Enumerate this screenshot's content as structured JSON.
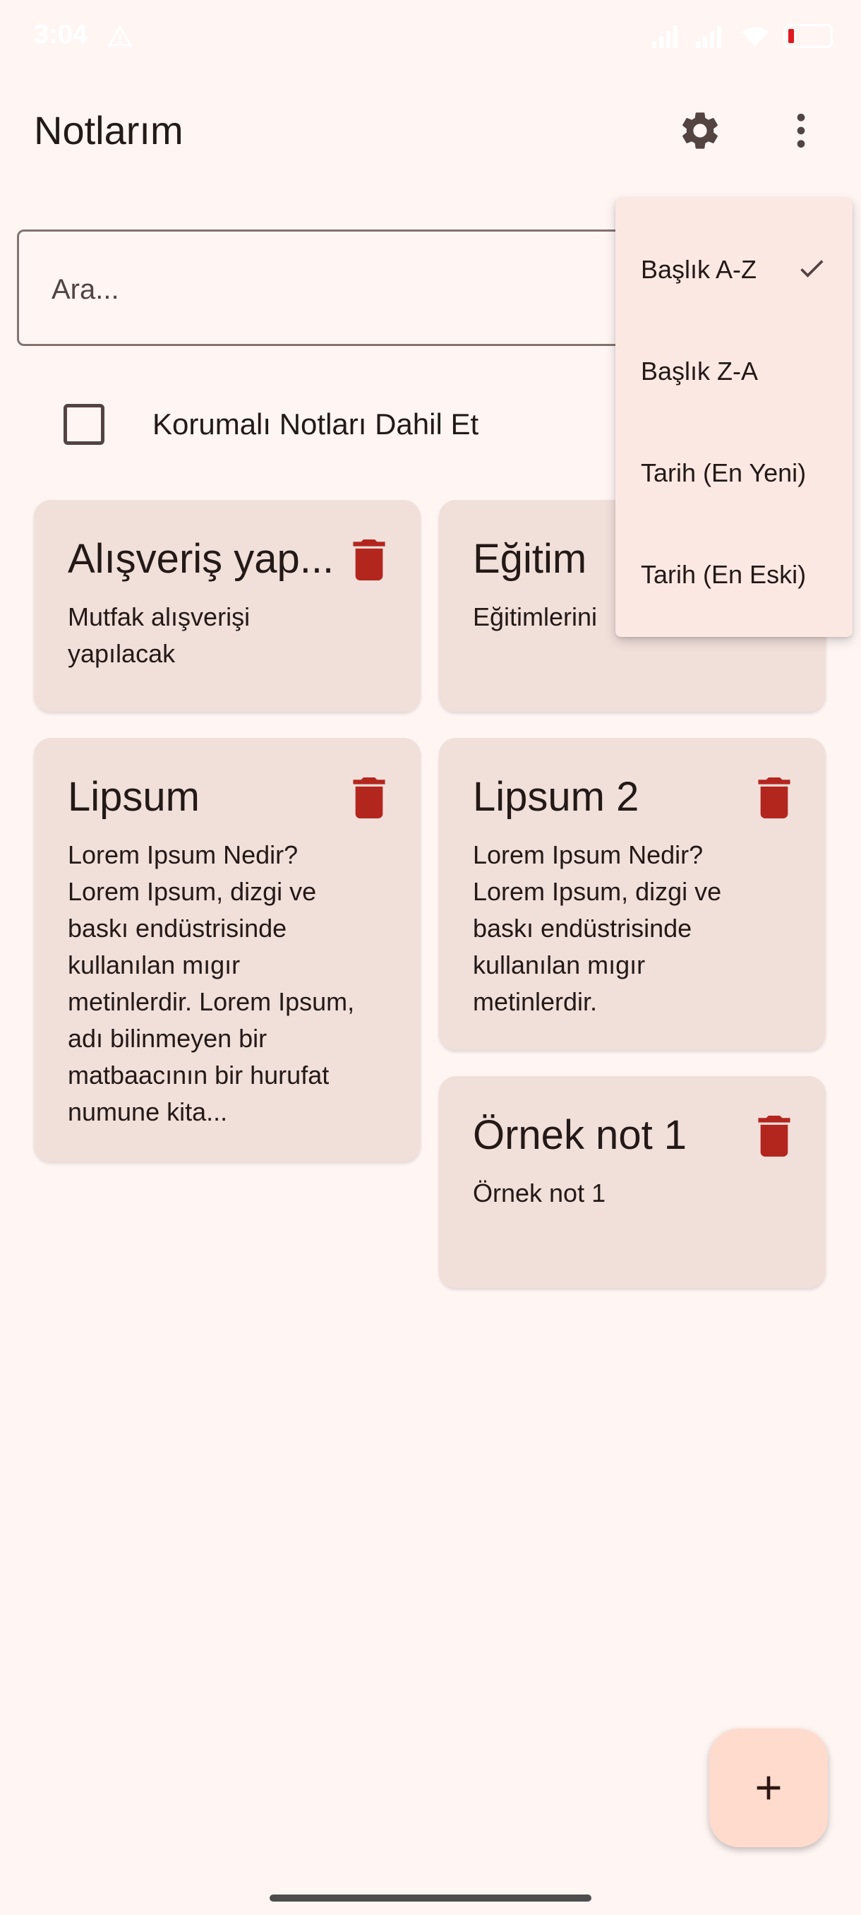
{
  "status_bar": {
    "time": "3:04"
  },
  "app_bar": {
    "title": "Notlarım",
    "settings_icon": "gear-icon",
    "more_icon": "more-vert-icon"
  },
  "search": {
    "placeholder": "Ara..."
  },
  "filter": {
    "include_protected_label": "Korumalı Notları Dahil Et",
    "checked": false
  },
  "sort_menu": {
    "items": [
      {
        "label": "Başlık A-Z",
        "selected": true
      },
      {
        "label": "Başlık Z-A",
        "selected": false
      },
      {
        "label": "Tarih (En Yeni)",
        "selected": false
      },
      {
        "label": "Tarih (En Eski)",
        "selected": false
      }
    ]
  },
  "notes": [
    {
      "title": "Alışveriş yap...",
      "body": "Mutfak alışverişi yapılacak"
    },
    {
      "title": "Eğitim",
      "body": "Eğitimlerini"
    },
    {
      "title": "Lipsum",
      "body": "Lorem Ipsum Nedir? Lorem Ipsum, dizgi ve baskı endüstrisinde kullanılan mıgır metinlerdir. Lorem Ipsum, adı bilinmeyen bir matbaacının bir hurufat numune kita..."
    },
    {
      "title": "Lipsum 2",
      "body": "Lorem Ipsum Nedir? Lorem Ipsum, dizgi ve baskı endüstrisinde kullanılan mıgır metinlerdir."
    },
    {
      "title": "Örnek not 1",
      "body": "Örnek not 1"
    }
  ],
  "fab": {
    "icon": "add-icon"
  },
  "colors": {
    "background": "#FFF6F4",
    "card": "#F1DFDA",
    "menu": "#FBE8E3",
    "trash": "#B3261E",
    "fab": "#FFDBCD",
    "icon": "#534341"
  }
}
